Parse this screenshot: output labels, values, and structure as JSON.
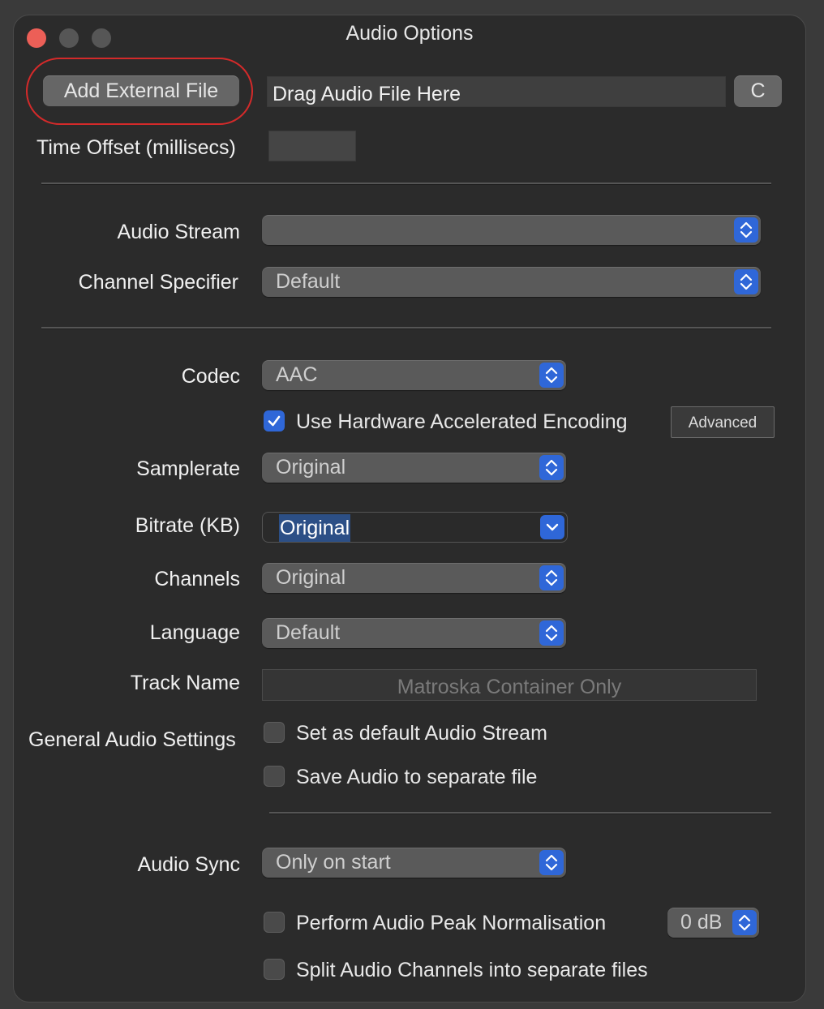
{
  "window": {
    "title": "Audio Options",
    "traffic_lights": {
      "close": "#ec5f57",
      "minimize": "#565656",
      "zoom": "#565656"
    }
  },
  "source": {
    "add_external_label": "Add External File",
    "drop_text": "Drag Audio File Here",
    "clear_label": "C",
    "highlight_color": "#d42a2a"
  },
  "time_offset": {
    "label": "Time Offset (millisecs)",
    "value": ""
  },
  "stream": {
    "audio_stream_label": "Audio Stream",
    "audio_stream_value": "",
    "channel_specifier_label": "Channel Specifier",
    "channel_specifier_value": "Default"
  },
  "encoding": {
    "codec_label": "Codec",
    "codec_value": "AAC",
    "hw_accel_label": "Use Hardware Accelerated Encoding",
    "hw_accel_checked": true,
    "advanced_label": "Advanced",
    "samplerate_label": "Samplerate",
    "samplerate_value": "Original",
    "bitrate_label": "Bitrate (KB)",
    "bitrate_value": "Original",
    "channels_label": "Channels",
    "channels_value": "Original",
    "language_label": "Language",
    "language_value": "Default",
    "track_name_label": "Track Name",
    "track_name_placeholder": "Matroska Container Only"
  },
  "general": {
    "label": "General Audio Settings",
    "set_default_label": "Set as default Audio Stream",
    "save_separate_label": "Save Audio to separate file"
  },
  "sync": {
    "audio_sync_label": "Audio Sync",
    "audio_sync_value": "Only on start",
    "peak_norm_label": "Perform Audio Peak Normalisation",
    "peak_norm_value": "0 dB",
    "split_channels_label": "Split Audio Channels into separate files"
  },
  "colors": {
    "accent": "#2f67d8",
    "selection": "#2c4f86"
  }
}
